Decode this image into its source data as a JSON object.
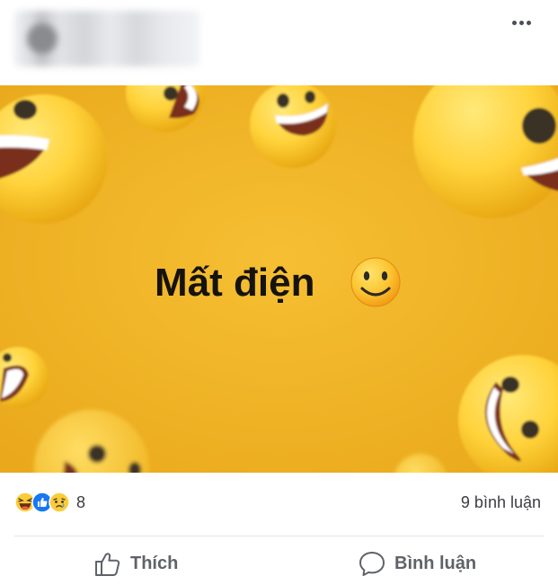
{
  "post": {
    "caption_text": "Mất điện"
  },
  "reactions": {
    "count": "8",
    "icons": [
      "haha-icon",
      "like-icon",
      "sad-icon"
    ]
  },
  "comments": {
    "count_label": "9 bình luận"
  },
  "actions": {
    "like_label": "Thích",
    "comment_label": "Bình luận"
  },
  "colors": {
    "image_background": "#f1b627",
    "emoji_yellow": "#ffd23a",
    "like_blue": "#1877f2",
    "action_text": "#5f6368"
  }
}
